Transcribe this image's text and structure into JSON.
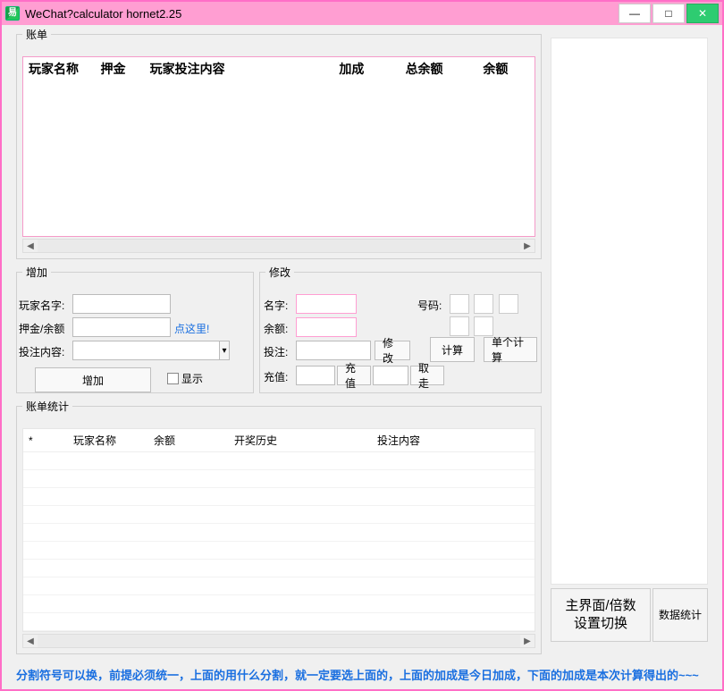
{
  "window": {
    "title": "WeChat?calculator hornet2.25"
  },
  "groups": {
    "bills": "账单",
    "add": "增加",
    "modify": "修改",
    "stats": "账单统计"
  },
  "billsHeaders": {
    "player": "玩家名称",
    "deposit": "押金",
    "betContent": "玩家投注内容",
    "bonus": "加成",
    "totalBalance": "总余额",
    "balance": "余额"
  },
  "statsHeaders": {
    "star": "*",
    "player": "玩家名称",
    "balance": "余额",
    "history": "开奖历史",
    "betContent": "投注内容"
  },
  "add": {
    "playerLabel": "玩家名字:",
    "depositLabel": "押金/余额",
    "betLabel": "投注内容:",
    "clickHere": "点这里!",
    "addBtn": "增加",
    "showChk": "显示"
  },
  "modify": {
    "nameLabel": "名字:",
    "balanceLabel": "余额:",
    "betLabel": "投注:",
    "modifyBtn": "修改",
    "rechargeLabel": "充值:",
    "rechargeBtn": "充值",
    "withdrawBtn": "取走",
    "numberLabel": "号码:",
    "calcBtn": "计算",
    "singleCalcBtn": "单个计算"
  },
  "bigButtons": {
    "mainSwitch": "主界面/倍数\n设置切换",
    "dataStats": "数据统计"
  },
  "footer": "分割符号可以换，前提必须统一，上面的用什么分割，就一定要选上面的，上面的加成是今日加成，下面的加成是本次计算得出的~~~"
}
